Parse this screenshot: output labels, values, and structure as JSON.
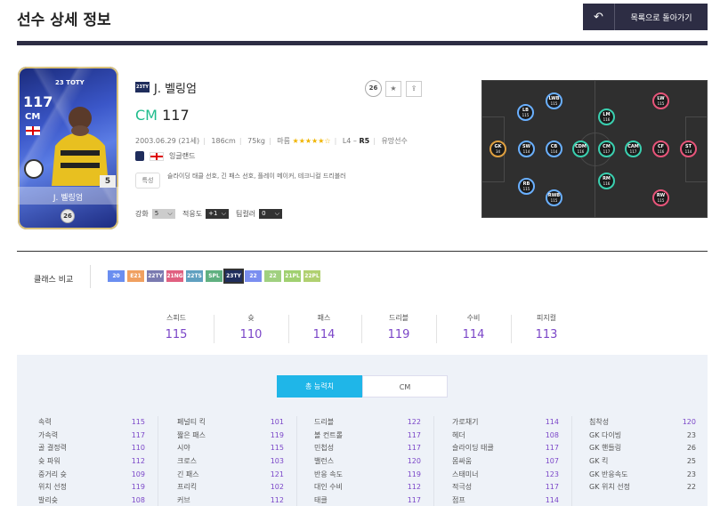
{
  "header": {
    "title": "선수 상세 정보",
    "back_label": "목록으로 돌아가기",
    "back_icon": "undo-icon"
  },
  "card": {
    "ovr": "117",
    "pos": "CM",
    "season": "23 TOTY",
    "name": "J. 벨링엄",
    "level": "5",
    "pay": "26",
    "season_badge": "23TY"
  },
  "player": {
    "season_badge": "23TY",
    "name": "J. 벨링엄",
    "position": "CM",
    "ovr": "117",
    "birth": "2003.06.29 (21세)",
    "height": "186cm",
    "weight": "75kg",
    "foot_label": "마름",
    "stars": "★★★★★☆",
    "skill_prefix": "L4 –",
    "skill_bold": "R5",
    "status": "유망선수",
    "nation": "잉글랜드",
    "traits_label": "특성",
    "traits": "슬라이딩 태클 선호, 긴 패스 선호, 플레이 메이커, 테크니컬 드리블러",
    "pay_badge": "26"
  },
  "controls": {
    "enhance_label": "강화",
    "enhance_value": "5",
    "adapt_label": "적응도",
    "adapt_value": "+1",
    "team_label": "팀컬러",
    "team_value": "0"
  },
  "pitch": {
    "positions": [
      {
        "pos": "LWB",
        "val": "115",
        "color": "#6ab0ff"
      },
      {
        "pos": "LB",
        "val": "115",
        "color": "#6ab0ff"
      },
      {
        "pos": "GK",
        "val": "34",
        "color": "#e0a040"
      },
      {
        "pos": "SW",
        "val": "114",
        "color": "#6ab0ff"
      },
      {
        "pos": "CB",
        "val": "114",
        "color": "#6ab0ff"
      },
      {
        "pos": "RB",
        "val": "115",
        "color": "#6ab0ff"
      },
      {
        "pos": "RWB",
        "val": "115",
        "color": "#6ab0ff"
      },
      {
        "pos": "LM",
        "val": "116",
        "color": "#3ad0b0"
      },
      {
        "pos": "CDM",
        "val": "116",
        "color": "#3ad0b0"
      },
      {
        "pos": "CM",
        "val": "117",
        "color": "#3ad0b0"
      },
      {
        "pos": "CAM",
        "val": "117",
        "color": "#3ad0b0"
      },
      {
        "pos": "RM",
        "val": "116",
        "color": "#3ad0b0"
      },
      {
        "pos": "LW",
        "val": "115",
        "color": "#e8557a"
      },
      {
        "pos": "CF",
        "val": "116",
        "color": "#e8557a"
      },
      {
        "pos": "ST",
        "val": "114",
        "color": "#e8557a"
      },
      {
        "pos": "RW",
        "val": "115",
        "color": "#e8557a"
      }
    ]
  },
  "class_compare": {
    "label": "클래스 비교",
    "badges": [
      {
        "text": "20",
        "color": "#6a8ef0"
      },
      {
        "text": "E21",
        "color": "#f0a060"
      },
      {
        "text": "22TY",
        "color": "#7a7ab0"
      },
      {
        "text": "21NG",
        "color": "#e06080"
      },
      {
        "text": "22TS",
        "color": "#60a0c0"
      },
      {
        "text": "SPL",
        "color": "#60b080"
      },
      {
        "text": "23TY",
        "color": "#1f2d5c"
      },
      {
        "text": "22",
        "color": "#7a8ef0"
      },
      {
        "text": "22",
        "color": "#a0d080"
      },
      {
        "text": "21PL",
        "color": "#a0d070"
      },
      {
        "text": "22PL",
        "color": "#b0d070"
      }
    ]
  },
  "summary": [
    {
      "label": "스피드",
      "value": "115"
    },
    {
      "label": "슛",
      "value": "110"
    },
    {
      "label": "패스",
      "value": "114"
    },
    {
      "label": "드리블",
      "value": "119"
    },
    {
      "label": "수비",
      "value": "114"
    },
    {
      "label": "피지컬",
      "value": "113"
    }
  ],
  "tabs": {
    "total": "총 능력치",
    "pos": "CM"
  },
  "stat_columns": [
    [
      {
        "n": "속력",
        "v": "115"
      },
      {
        "n": "가속력",
        "v": "117"
      },
      {
        "n": "골 결정력",
        "v": "110"
      },
      {
        "n": "슛 파워",
        "v": "112"
      },
      {
        "n": "중거리 슛",
        "v": "109"
      },
      {
        "n": "위치 선정",
        "v": "119"
      },
      {
        "n": "발리슛",
        "v": "108"
      }
    ],
    [
      {
        "n": "페널티 킥",
        "v": "101"
      },
      {
        "n": "짧은 패스",
        "v": "119"
      },
      {
        "n": "시야",
        "v": "115"
      },
      {
        "n": "크로스",
        "v": "103"
      },
      {
        "n": "긴 패스",
        "v": "121"
      },
      {
        "n": "프리킥",
        "v": "102"
      },
      {
        "n": "커브",
        "v": "112"
      }
    ],
    [
      {
        "n": "드리블",
        "v": "122"
      },
      {
        "n": "볼 컨트롤",
        "v": "117"
      },
      {
        "n": "민첩성",
        "v": "117"
      },
      {
        "n": "밸런스",
        "v": "120"
      },
      {
        "n": "반응 속도",
        "v": "119"
      },
      {
        "n": "대인 수비",
        "v": "112"
      },
      {
        "n": "태클",
        "v": "117"
      }
    ],
    [
      {
        "n": "가로채기",
        "v": "114"
      },
      {
        "n": "헤더",
        "v": "108"
      },
      {
        "n": "슬라이딩 태클",
        "v": "117"
      },
      {
        "n": "몸싸움",
        "v": "107"
      },
      {
        "n": "스태미너",
        "v": "123"
      },
      {
        "n": "적극성",
        "v": "117"
      },
      {
        "n": "점프",
        "v": "114"
      }
    ],
    [
      {
        "n": "침착성",
        "v": "120"
      },
      {
        "n": "GK 다이빙",
        "v": "23"
      },
      {
        "n": "GK 핸들링",
        "v": "26"
      },
      {
        "n": "GK 킥",
        "v": "25"
      },
      {
        "n": "GK 반응속도",
        "v": "23"
      },
      {
        "n": "GK 위치 선정",
        "v": "22"
      }
    ]
  ]
}
